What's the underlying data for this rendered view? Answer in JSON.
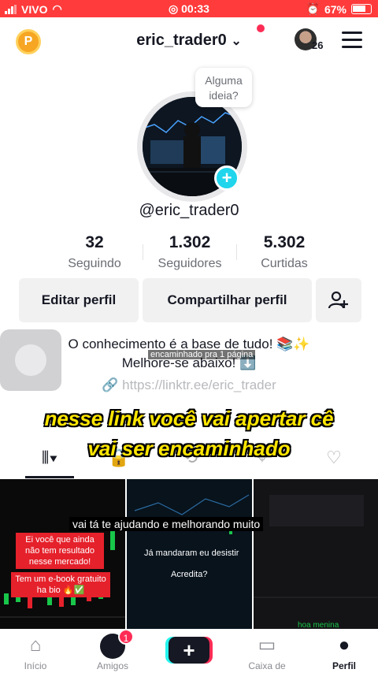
{
  "status_bar": {
    "carrier": "VIVO",
    "time": "00:33",
    "battery": "67%"
  },
  "header": {
    "coin_label": "P",
    "username": "eric_trader0",
    "friends_count": "26"
  },
  "profile": {
    "bubble_text": "Alguma ideia?",
    "handle": "@eric_trader0",
    "stats": [
      {
        "value": "32",
        "label": "Seguindo"
      },
      {
        "value": "1.302",
        "label": "Seguidores"
      },
      {
        "value": "5.302",
        "label": "Curtidas"
      }
    ],
    "edit_button": "Editar perfil",
    "share_button": "Compartilhar perfil",
    "bio_line1": "O conhecimento é a base de tudo! 📚✨",
    "bio_line2": "Melhore-se abaixo! ⬇️",
    "link": "https://linktr.ee/eric_trader"
  },
  "captions": {
    "small": "encaminhado pra 1 página",
    "big_line1": "nesse link você vai apertar cê",
    "big_line2": "vai ser encaminhado",
    "bottom": "vai tá te ajudando e melhorando muito"
  },
  "videos": [
    {
      "label1": "Ei você que ainda não tem resultado nesse mercado!",
      "label2": "Tem um e-book gratuito ha bio 🔥✅"
    },
    {
      "text1": "Já mandaram eu desistir",
      "text2": "Acredita?"
    },
    {
      "text1": "hoa menina"
    }
  ],
  "bottom_nav": {
    "items": [
      {
        "label": "Início"
      },
      {
        "label": "Amigos",
        "badge": "1"
      },
      {
        "label": "+"
      },
      {
        "label": "Caixa de entrada"
      },
      {
        "label": "Perfil"
      }
    ]
  },
  "colors": {
    "status_bar": "#ff3b3b",
    "accent_cyan": "#20d5ec",
    "accent_red": "#fe2c55",
    "caption_yellow": "#ffe600"
  }
}
